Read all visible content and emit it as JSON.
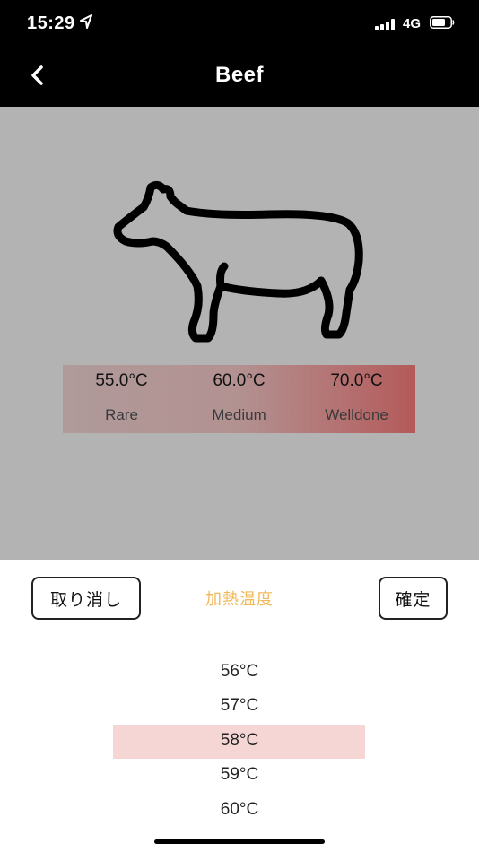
{
  "status_bar": {
    "time": "15:29",
    "network": "4G"
  },
  "nav": {
    "title": "Beef",
    "back_icon": "chevron-left-icon"
  },
  "hero": {
    "illustration_icon": "cow-outline-icon",
    "levels": [
      {
        "temp": "55.0°C",
        "name": "Rare"
      },
      {
        "temp": "60.0°C",
        "name": "Medium"
      },
      {
        "temp": "70.0°C",
        "name": "Welldone"
      }
    ],
    "scale_colors": [
      "#b09a9a",
      "#b45a5a"
    ]
  },
  "picker": {
    "cancel_label": "取り消し",
    "title": "加熱温度",
    "confirm_label": "確定",
    "options": [
      "56°C",
      "57°C",
      "58°C",
      "59°C",
      "60°C"
    ],
    "selected": "58°C",
    "title_color": "#f0b85a",
    "highlight_color": "#f5d6d4"
  }
}
